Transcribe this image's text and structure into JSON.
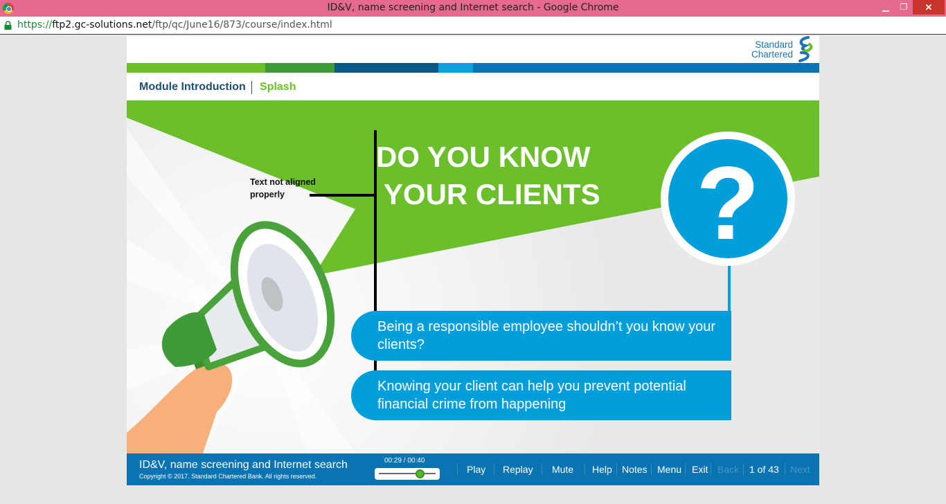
{
  "browser": {
    "window_title": "ID&V, name screening and Internet search - Google Chrome",
    "url_scheme": "https://",
    "url_host": "ftp2.gc-solutions.net",
    "url_path": "/ftp/qc/June16/873/course/index.html",
    "minimize_glyph": "▁",
    "restore_glyph": "❐",
    "close_glyph": "✕"
  },
  "brand": {
    "line1": "Standard",
    "line2": "Chartered",
    "colors": {
      "blue": "#1a72b8",
      "green": "#6abf2a"
    }
  },
  "nav": {
    "crumb_module": "Module Introduction",
    "crumb_page": "Splash"
  },
  "slide": {
    "headline": "DO YOU KNOW\n YOUR CLIENTS",
    "annotation": "Text not aligned properly",
    "question_mark": "?",
    "callout_1": "Being a responsible employee shouldn’t you know your clients?",
    "callout_2": "Knowing your client can help you prevent potential financial crime from happening",
    "colors": {
      "green": "#6abf2a",
      "blue": "#009fdb"
    }
  },
  "footer": {
    "course_title": "ID&V, name screening and Internet search",
    "copyright": "Copyright © 2017. Standard Chartered Bank. All rights reserved.",
    "time": "00:29 / 00:40",
    "progress": 0.725,
    "buttons": {
      "play": "Play",
      "replay": "Replay",
      "mute": "Mute",
      "help": "Help",
      "notes": "Notes",
      "menu": "Menu",
      "exit": "Exit",
      "back": "Back",
      "next": "Next"
    },
    "page_indicator": "1 of 43"
  }
}
